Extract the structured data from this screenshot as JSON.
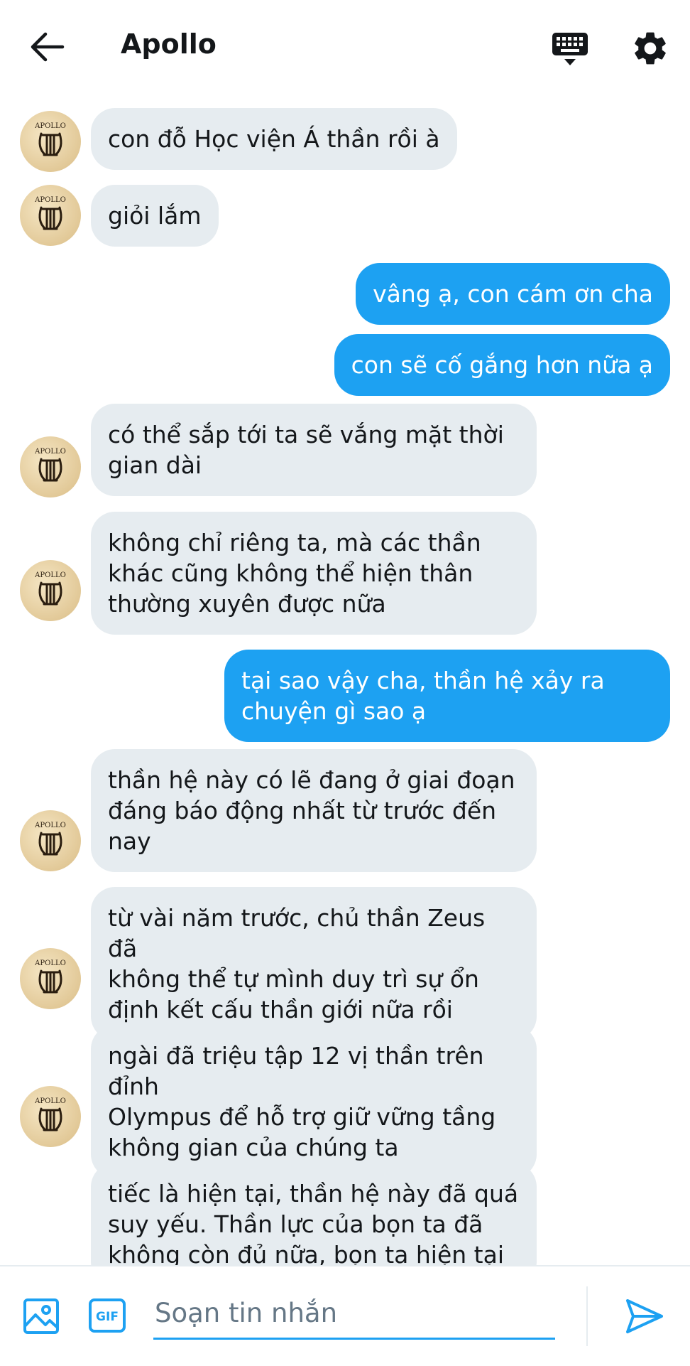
{
  "header": {
    "title": "Apollo",
    "icons": {
      "back": "arrow-left-icon",
      "keyboard": "keyboard-icon",
      "settings": "gear-icon"
    }
  },
  "avatar": {
    "label": "APOLLO",
    "icon": "lyre-icon"
  },
  "messages": [
    {
      "side": "in",
      "text": "con đỗ Học viện Á thần rồi à"
    },
    {
      "side": "in",
      "text": "giỏi lắm"
    },
    {
      "side": "out",
      "text": "vâng ạ, con cám ơn cha"
    },
    {
      "side": "out",
      "text": "con sẽ cố gắng hơn nữa ạ"
    },
    {
      "side": "in",
      "text": "có thể sắp tới ta sẽ vắng mặt thời\ngian dài"
    },
    {
      "side": "in",
      "text": "không chỉ riêng ta, mà các thần\nkhác cũng không thể hiện thân\nthường xuyên được nữa"
    },
    {
      "side": "out",
      "text": "tại sao vậy cha, thần hệ xảy ra\nchuyện gì sao ạ"
    },
    {
      "side": "in",
      "text": "thần hệ này có lẽ đang ở giai đoạn\nđáng báo động nhất từ trước đến\nnay"
    },
    {
      "side": "in",
      "text": "từ vài năm trước, chủ thần Zeus đã\nkhông thể tự mình duy trì sự ổn\nđịnh kết cấu thần giới nữa rồi"
    },
    {
      "side": "in",
      "text": "ngài đã triệu tập 12 vị thần trên đỉnh\nOlympus để hỗ trợ giữ vững tầng\nkhông gian của chúng ta"
    },
    {
      "side": "in",
      "text": "tiếc là hiện tại, thần hệ này đã quá\nsuy yếu. Thần lực của bọn ta đã\nkhông còn đủ nữa, bọn ta hiện tại"
    }
  ],
  "composer": {
    "placeholder": "Soạn tin nhắn",
    "gif_label": "GIF",
    "icons": {
      "image": "image-icon",
      "gif": "gif-icon",
      "send": "send-icon"
    }
  },
  "colors": {
    "accent": "#1da1f2",
    "incoming_bubble": "#e6ecf0",
    "text": "#14171a",
    "placeholder": "#657786"
  }
}
